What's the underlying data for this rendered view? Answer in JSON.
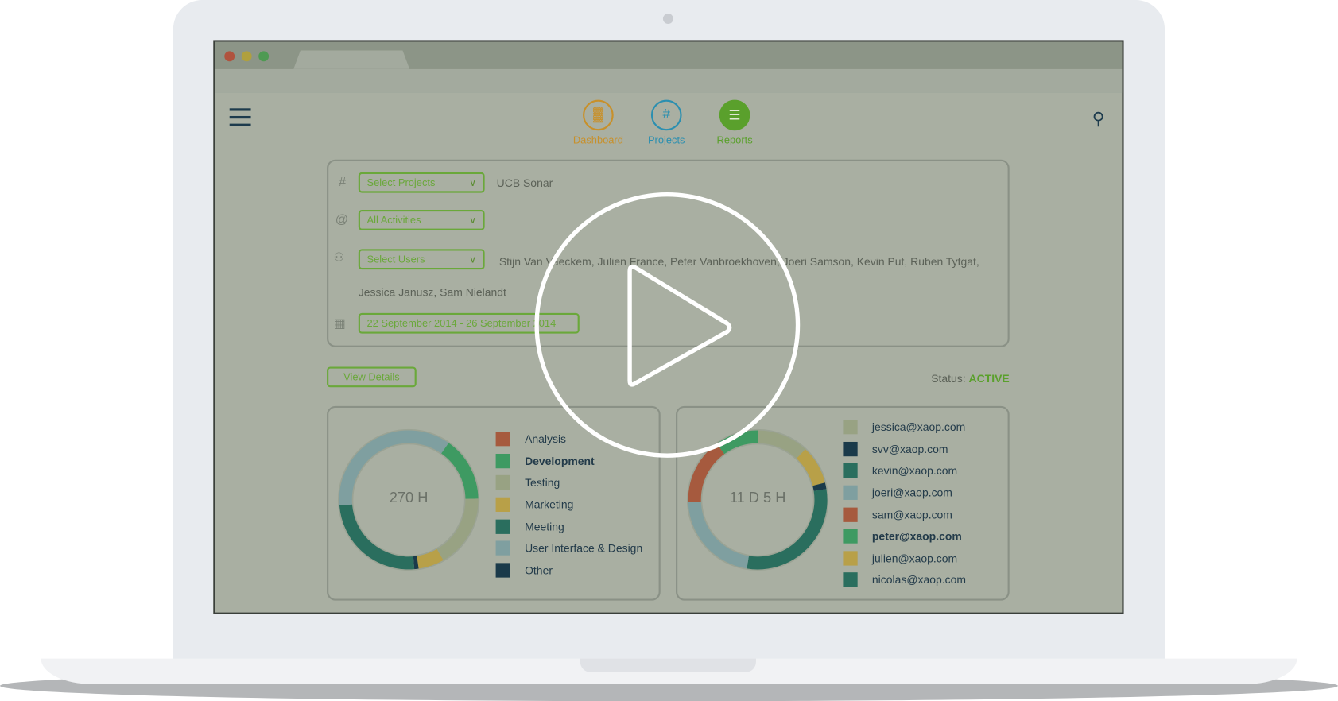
{
  "nav": {
    "items": [
      {
        "label": "Dashboard",
        "icon": "bar-chart-icon",
        "color": "#c8902a"
      },
      {
        "label": "Projects",
        "icon": "hash-icon",
        "color": "#2b8fb0"
      },
      {
        "label": "Reports",
        "icon": "list-icon",
        "color": "#5aa02c"
      }
    ]
  },
  "filters": {
    "projects": {
      "label": "Select Projects",
      "value": "UCB Sonar"
    },
    "activities": {
      "label": "All Activities"
    },
    "users": {
      "label": "Select Users",
      "value_line1": "Stijn Van Vaeckem, Julien France, Peter Vanbroekhoven, Joeri Samson, Kevin Put, Ruben Tytgat,",
      "value_line2": "Jessica Janusz, Sam Nielandt"
    },
    "date_range": "22 September 2014 - 26 September 2014"
  },
  "view_details": "View Details",
  "status": {
    "label": "Status:",
    "value": "ACTIVE",
    "color": "#5aa02c"
  },
  "activity_chart": {
    "center": "270 H",
    "legend": [
      {
        "label": "Analysis",
        "color": "#a65a3e"
      },
      {
        "label": "Development",
        "color": "#3e9a62",
        "bold": true
      },
      {
        "label": "Testing",
        "color": "#98a283"
      },
      {
        "label": "Marketing",
        "color": "#b8a048"
      },
      {
        "label": "Meeting",
        "color": "#2a6e5e"
      },
      {
        "label": "User Interface & Design",
        "color": "#7f9fa0"
      },
      {
        "label": "Other",
        "color": "#1a3a4a"
      }
    ],
    "segments": [
      {
        "label": "Development",
        "fraction": 0.15
      },
      {
        "label": "Testing",
        "fraction": 0.17
      },
      {
        "label": "Marketing",
        "fraction": 0.06
      },
      {
        "label": "Other",
        "fraction": 0.01
      },
      {
        "label": "Meeting",
        "fraction": 0.25
      },
      {
        "label": "User Interface & Design",
        "fraction": 0.36
      }
    ],
    "start_angle": 35
  },
  "user_chart": {
    "center": "11 D 5 H",
    "legend": [
      {
        "label": "jessica@xaop.com",
        "color": "#98a283"
      },
      {
        "label": "svv@xaop.com",
        "color": "#1a3a4a"
      },
      {
        "label": "kevin@xaop.com",
        "color": "#2a6e5e"
      },
      {
        "label": "joeri@xaop.com",
        "color": "#7f9fa0"
      },
      {
        "label": "sam@xaop.com",
        "color": "#a65a3e"
      },
      {
        "label": "peter@xaop.com",
        "color": "#3e9a62",
        "bold": true
      },
      {
        "label": "julien@xaop.com",
        "color": "#b8a048"
      },
      {
        "label": "nicolas@xaop.com",
        "color": "#2a6e5e"
      }
    ],
    "segments": [
      {
        "label": "jessica@xaop.com",
        "color": "#98a283",
        "fraction": 0.12
      },
      {
        "label": "julien@xaop.com",
        "color": "#b8a048",
        "fraction": 0.09
      },
      {
        "label": "svv@xaop.com",
        "color": "#1a3a4a",
        "fraction": 0.015
      },
      {
        "label": "kevin@xaop.com",
        "color": "#2a6e5e",
        "fraction": 0.3
      },
      {
        "label": "joeri@xaop.com",
        "color": "#7f9fa0",
        "fraction": 0.22
      },
      {
        "label": "sam@xaop.com",
        "color": "#a65a3e",
        "fraction": 0.155
      },
      {
        "label": "peter@xaop.com",
        "color": "#3e9a62",
        "fraction": 0.1
      }
    ],
    "start_angle": 0
  }
}
